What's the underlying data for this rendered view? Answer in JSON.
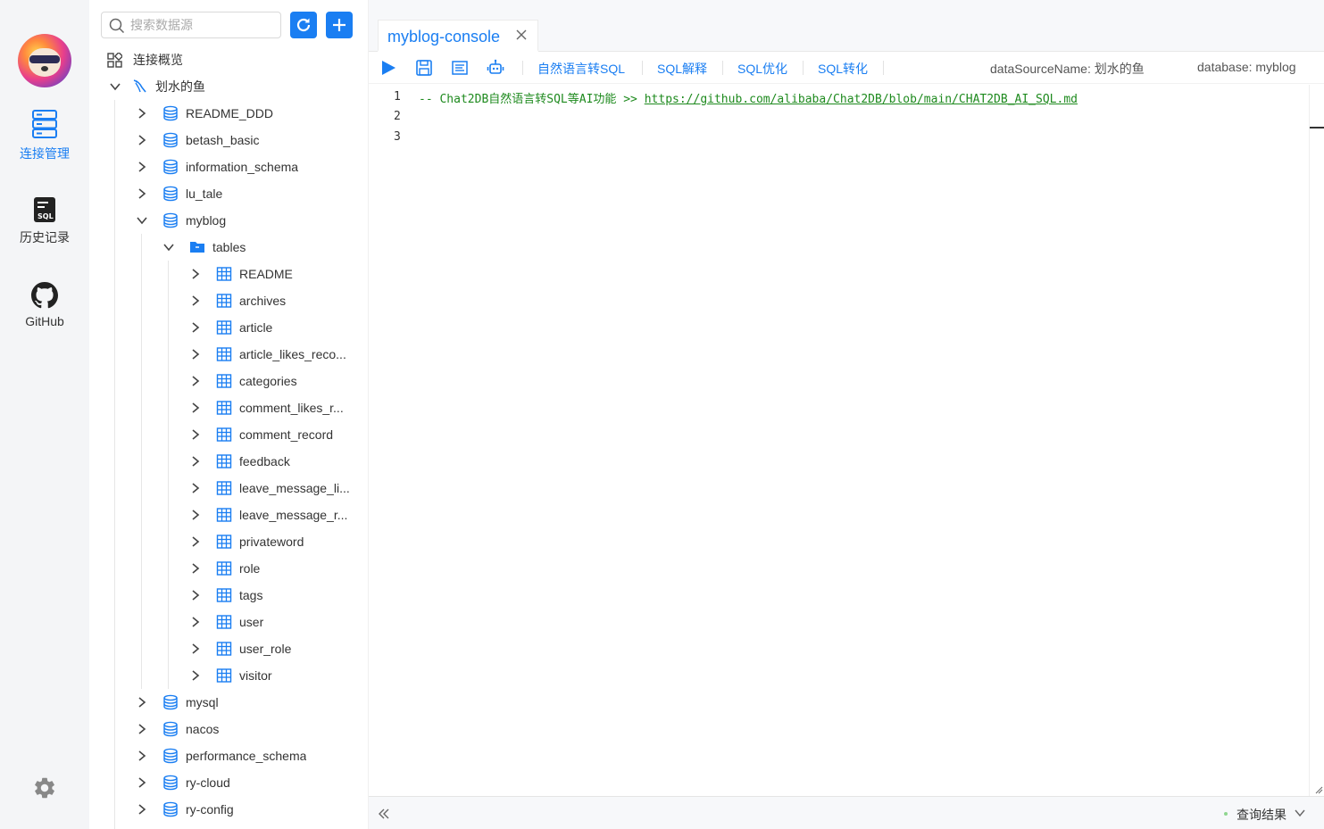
{
  "rail": {
    "items": [
      {
        "label": "连接管理",
        "icon": "server-icon",
        "active": true
      },
      {
        "label": "历史记录",
        "icon": "sql-file-icon",
        "active": false
      },
      {
        "label": "GitHub",
        "icon": "github-icon",
        "active": false
      }
    ],
    "settings_icon": "gear-icon",
    "accent_color": "#1a7ef2"
  },
  "tree": {
    "search_placeholder": "搜索数据源",
    "refresh_icon": "refresh-icon",
    "add_icon": "plus-icon",
    "overview_label": "连接概览",
    "connection_label": "划水的鱼",
    "databases_before": [
      "README_DDD",
      "betash_basic",
      "information_schema",
      "lu_tale"
    ],
    "open_database": "myblog",
    "folder_label": "tables",
    "tables": [
      "README",
      "archives",
      "article",
      "article_likes_reco...",
      "categories",
      "comment_likes_r...",
      "comment_record",
      "feedback",
      "leave_message_li...",
      "leave_message_r...",
      "privateword",
      "role",
      "tags",
      "user",
      "user_role",
      "visitor"
    ],
    "databases_after": [
      "mysql",
      "nacos",
      "performance_schema",
      "ry-cloud",
      "ry-config"
    ]
  },
  "tab": {
    "label": "myblog-console",
    "close_icon": "close-icon"
  },
  "toolbar": {
    "run_icon": "play-icon",
    "save_icon": "save-icon",
    "format_icon": "format-icon",
    "ai_icon": "robot-icon",
    "links": [
      "自然语言转SQL",
      "SQL解释",
      "SQL优化",
      "SQL转化"
    ],
    "datasource_info": "dataSourceName: 划水的鱼",
    "database_info": "database: myblog"
  },
  "editor": {
    "line_numbers": [
      "1",
      "2",
      "3"
    ],
    "line1_prefix": "-- Chat2DB自然语言转SQL等AI功能 >> ",
    "line1_url": "https://github.com/alibaba/Chat2DB/blob/main/CHAT2DB_AI_SQL.md"
  },
  "bottom": {
    "collapse_icon": "double-chevron-left-icon",
    "result_label": "查询结果",
    "result_chevron_icon": "chevron-down-icon"
  }
}
